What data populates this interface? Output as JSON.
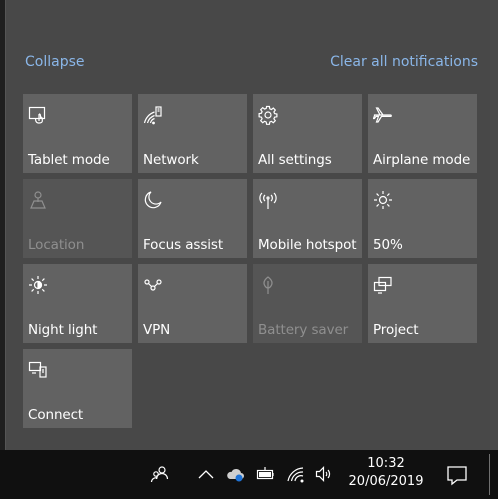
{
  "action_center": {
    "collapse_label": "Collapse",
    "clear_label": "Clear all notifications",
    "tiles": [
      {
        "label": "Tablet mode",
        "icon": "tablet-mode-icon",
        "enabled": true
      },
      {
        "label": "Network",
        "icon": "network-icon",
        "enabled": true
      },
      {
        "label": "All settings",
        "icon": "settings-gear-icon",
        "enabled": true
      },
      {
        "label": "Airplane mode",
        "icon": "airplane-icon",
        "enabled": true
      },
      {
        "label": "Location",
        "icon": "location-icon",
        "enabled": false
      },
      {
        "label": "Focus assist",
        "icon": "moon-icon",
        "enabled": true
      },
      {
        "label": "Mobile hotspot",
        "icon": "hotspot-icon",
        "enabled": true
      },
      {
        "label": "50%",
        "icon": "brightness-icon",
        "enabled": true
      },
      {
        "label": "Night light",
        "icon": "night-light-icon",
        "enabled": true
      },
      {
        "label": "VPN",
        "icon": "vpn-icon",
        "enabled": true
      },
      {
        "label": "Battery saver",
        "icon": "battery-saver-icon",
        "enabled": false
      },
      {
        "label": "Project",
        "icon": "project-icon",
        "enabled": true
      },
      {
        "label": "Connect",
        "icon": "connect-icon",
        "enabled": true
      }
    ]
  },
  "taskbar": {
    "time": "10:32",
    "date": "20/06/2019",
    "tray_icons": [
      "people-icon",
      "chevron-up-icon",
      "onedrive-icon",
      "battery-icon",
      "wifi-icon",
      "volume-icon"
    ],
    "notification_icon": "action-center-icon"
  },
  "colors": {
    "panel": "#484848",
    "tile": "#626262",
    "tile_disabled": "#555555",
    "link": "#8ab6e8",
    "taskbar": "#101010"
  }
}
